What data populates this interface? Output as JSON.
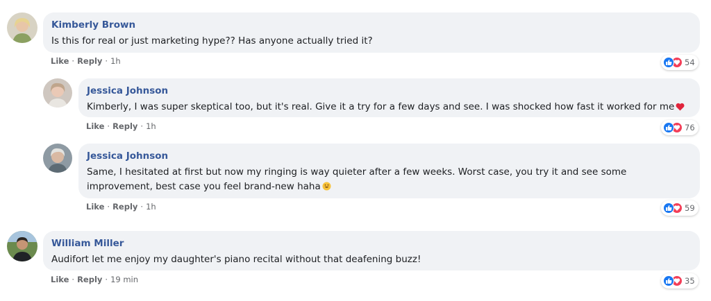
{
  "actions": {
    "like": "Like",
    "reply": "Reply",
    "separator": "·"
  },
  "comments": [
    {
      "author": "Kimberly Brown",
      "text": "Is this for real or just marketing hype?? Has anyone actually tried it?",
      "time": "1h",
      "reactions": "54"
    },
    {
      "author": "Jessica Johnson",
      "text": "Kimberly, I was super skeptical too, but it's real. Give it a try for a few days and see. I was shocked how fast it worked for me",
      "time": "1h",
      "reactions": "76"
    },
    {
      "author": "Jessica Johnson",
      "text": "Same, I hesitated at first but now my ringing is way quieter after a few weeks. Worst case, you try it and see some improvement, best case you feel brand-new haha",
      "time": "1h",
      "reactions": "59"
    },
    {
      "author": "William Miller",
      "text": "Audifort let me enjoy my daughter's piano recital without that deafening buzz!",
      "time": "19 min",
      "reactions": "35"
    }
  ],
  "colors": {
    "author": "#365899",
    "bubble": "#f0f2f5",
    "like": "#1877f2",
    "love": "#f33e58",
    "meta": "#65676b"
  },
  "icons": [
    "like-icon",
    "love-icon",
    "heart-emoji-icon",
    "smile-emoji-icon"
  ]
}
